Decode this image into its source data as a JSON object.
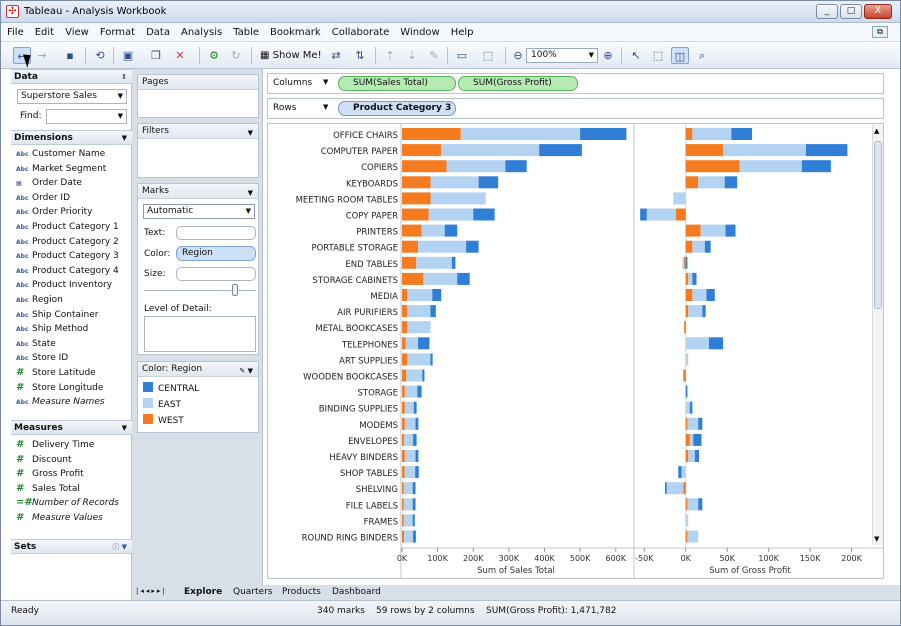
{
  "window": {
    "title": "Tableau - Analysis Workbook",
    "controls": [
      "_",
      "□",
      "X"
    ]
  },
  "menu": [
    "File",
    "Edit",
    "View",
    "Format",
    "Data",
    "Analysis",
    "Table",
    "Bookmark",
    "Collaborate",
    "Window",
    "Help"
  ],
  "toolbar": {
    "show_me_label": "Show Me!",
    "zoom": "100%"
  },
  "left": {
    "data_header": "Data",
    "datasource": "Superstore Sales",
    "find_label": "Find:",
    "dimensions_header": "Dimensions",
    "dimensions": [
      "Customer Name",
      "Market Segment",
      "Order Date",
      "Order ID",
      "Order Priority",
      "Product Category 1",
      "Product Category 2",
      "Product Category 3",
      "Product Category 4",
      "Product Inventory",
      "Region",
      "Ship Container",
      "Ship Method",
      "State",
      "Store ID",
      "Store Latitude",
      "Store Longitude",
      "Measure Names"
    ],
    "measures_header": "Measures",
    "measures": [
      "Delivery Time",
      "Discount",
      "Gross Profit",
      "Sales Total",
      "Number of Records",
      "Measure Values"
    ],
    "sets_header": "Sets"
  },
  "mid": {
    "pages": "Pages",
    "filters": "Filters",
    "marks": "Marks",
    "mark_type": "Automatic",
    "text_label": "Text:",
    "color_label": "Color:",
    "color_value": "Region",
    "size_label": "Size:",
    "lod_label": "Level of Detail:",
    "legend_title": "Color: Region",
    "legend": [
      {
        "name": "CENTRAL",
        "color": "#2f7fd6"
      },
      {
        "name": "EAST",
        "color": "#b3d3f3"
      },
      {
        "name": "WEST",
        "color": "#f47b1f"
      }
    ]
  },
  "shelves": {
    "columns_label": "Columns",
    "columns": [
      "SUM(Sales Total)",
      "SUM(Gross Profit)"
    ],
    "rows_label": "Rows",
    "rows": [
      "Product Category 3"
    ]
  },
  "chart_data": {
    "type": "bar",
    "stacked": true,
    "categories": [
      "OFFICE CHAIRS",
      "COMPUTER PAPER",
      "COPIERS",
      "KEYBOARDS",
      "MEETING ROOM TABLES",
      "COPY PAPER",
      "PRINTERS",
      "PORTABLE STORAGE",
      "END TABLES",
      "STORAGE CABINETS",
      "MEDIA",
      "AIR PURIFIERS",
      "METAL BOOKCASES",
      "TELEPHONES",
      "ART SUPPLIES",
      "WOODEN BOOKCASES",
      "STORAGE",
      "BINDING SUPPLIES",
      "MODEMS",
      "ENVELOPES",
      "HEAVY BINDERS",
      "SHOP TABLES",
      "SHELVING",
      "FILE LABELS",
      "FRAMES",
      "ROUND RING BINDERS"
    ],
    "panels": [
      {
        "xlabel": "Sum of Sales Total",
        "xlim": [
          0,
          640000
        ],
        "ticks": [
          "0K",
          "100K",
          "200K",
          "300K",
          "400K",
          "500K",
          "600K"
        ],
        "tick_values": [
          0,
          100000,
          200000,
          300000,
          400000,
          500000,
          600000
        ],
        "series": [
          {
            "name": "WEST",
            "values": [
              165000,
              110000,
              125000,
              80000,
              80000,
              75000,
              55000,
              45000,
              40000,
              60000,
              15000,
              15000,
              15000,
              10000,
              15000,
              12000,
              8000,
              8000,
              8000,
              6000,
              8000,
              7000,
              5000,
              5000,
              5000,
              6000
            ]
          },
          {
            "name": "EAST",
            "values": [
              335000,
              275000,
              165000,
              135000,
              155000,
              125000,
              65000,
              135000,
              100000,
              95000,
              70000,
              65000,
              65000,
              35000,
              65000,
              45000,
              35000,
              25000,
              30000,
              25000,
              30000,
              30000,
              25000,
              25000,
              25000,
              25000
            ]
          },
          {
            "name": "CENTRAL",
            "values": [
              130000,
              120000,
              60000,
              55000,
              0,
              60000,
              35000,
              35000,
              10000,
              35000,
              25000,
              15000,
              0,
              32000,
              6000,
              6000,
              12000,
              8000,
              8000,
              10000,
              8000,
              10000,
              8000,
              8000,
              6000,
              8000
            ]
          }
        ]
      },
      {
        "xlabel": "Sum of Gross Profit",
        "xlim": [
          -60000,
          215000
        ],
        "ticks": [
          "-50K",
          "0K",
          "50K",
          "100K",
          "150K",
          "200K"
        ],
        "tick_values": [
          -50000,
          0,
          50000,
          100000,
          150000,
          200000
        ],
        "series": [
          {
            "name": "WEST",
            "values": [
              8000,
              45000,
              65000,
              15000,
              0,
              -12000,
              18000,
              8000,
              -2000,
              3000,
              8000,
              3000,
              -2000,
              0,
              0,
              -3000,
              0,
              0,
              2000,
              5000,
              3000,
              0,
              -3000,
              2000,
              0,
              2000
            ]
          },
          {
            "name": "EAST",
            "values": [
              47000,
              100000,
              75000,
              32000,
              -15000,
              -35000,
              30000,
              15000,
              -2000,
              5000,
              17000,
              17000,
              0,
              28000,
              3000,
              0,
              0,
              5000,
              13000,
              4000,
              8000,
              -5000,
              -20000,
              13000,
              3000,
              13000
            ]
          },
          {
            "name": "CENTRAL",
            "values": [
              25000,
              50000,
              35000,
              15000,
              0,
              -8000,
              12000,
              7000,
              2000,
              5000,
              10000,
              4000,
              0,
              17000,
              0,
              0,
              2000,
              3000,
              5000,
              10000,
              5000,
              -4000,
              -2000,
              5000,
              0,
              0
            ]
          }
        ]
      }
    ]
  },
  "tabs": [
    "Explore",
    "Quarters",
    "Products",
    "Dashboard"
  ],
  "status": {
    "ready": "Ready",
    "marks": "340 marks",
    "rows_cols": "59 rows by 2 columns",
    "sum": "SUM(Gross Profit): 1,471,782"
  }
}
